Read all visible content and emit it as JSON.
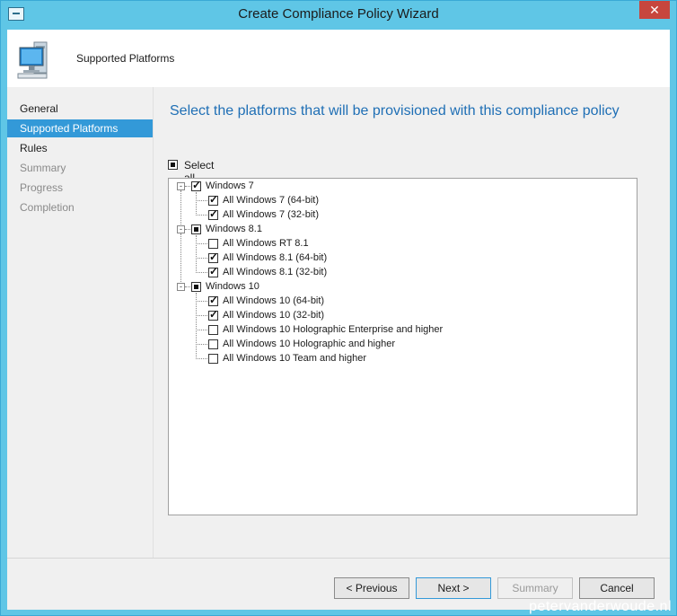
{
  "window": {
    "title": "Create Compliance Policy Wizard",
    "close_glyph": "✕"
  },
  "header": {
    "title": "Supported Platforms"
  },
  "nav": {
    "items": [
      {
        "label": "General",
        "state": "enabled"
      },
      {
        "label": "Supported Platforms",
        "state": "active"
      },
      {
        "label": "Rules",
        "state": "enabled"
      },
      {
        "label": "Summary",
        "state": "disabled"
      },
      {
        "label": "Progress",
        "state": "disabled"
      },
      {
        "label": "Completion",
        "state": "disabled"
      }
    ]
  },
  "main": {
    "heading": "Select the platforms that will be provisioned with this compliance policy",
    "select_all_label": "Select all",
    "select_all_state": "partial"
  },
  "tree": {
    "groups": [
      {
        "label": "Windows 7",
        "state": "checked",
        "children": [
          {
            "label": "All Windows 7 (64-bit)",
            "checked": true
          },
          {
            "label": "All Windows 7 (32-bit)",
            "checked": true
          }
        ]
      },
      {
        "label": "Windows 8.1",
        "state": "partial",
        "children": [
          {
            "label": "All Windows RT 8.1",
            "checked": false
          },
          {
            "label": "All Windows 8.1 (64-bit)",
            "checked": true
          },
          {
            "label": "All Windows 8.1 (32-bit)",
            "checked": true
          }
        ]
      },
      {
        "label": "Windows 10",
        "state": "partial",
        "children": [
          {
            "label": "All Windows 10 (64-bit)",
            "checked": true
          },
          {
            "label": "All Windows 10 (32-bit)",
            "checked": true
          },
          {
            "label": "All Windows 10 Holographic Enterprise and higher",
            "checked": false
          },
          {
            "label": "All Windows 10 Holographic and higher",
            "checked": false
          },
          {
            "label": "All Windows 10 Team and higher",
            "checked": false
          }
        ]
      }
    ]
  },
  "buttons": {
    "previous": "< Previous",
    "next": "Next >",
    "summary": "Summary",
    "cancel": "Cancel"
  },
  "watermark": "petervanderwoude.nl",
  "colors": {
    "titlebar": "#5fc6e6",
    "accent": "#3399d8",
    "heading": "#1f6fb5",
    "close": "#c7463e"
  },
  "icons": {
    "window": "wizard-window-icon",
    "header": "computer-monitor-icon"
  }
}
